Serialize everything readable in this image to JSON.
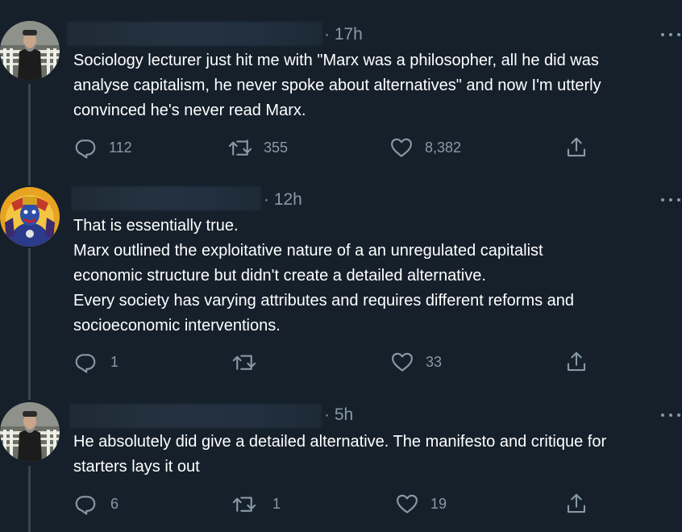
{
  "tweets": [
    {
      "time": "· 17h",
      "lines": [
        "Sociology lecturer just hit me with \"Marx was a philosopher, all he did was",
        "analyse capitalism, he never spoke about alternatives\" and now I'm utterly",
        "convinced he's never read Marx."
      ],
      "actions": {
        "reply": "112",
        "retweet": "355",
        "like": "8,382"
      }
    },
    {
      "time": "· 12h",
      "lines": [
        "That is essentially true.",
        "Marx outlined the exploitative nature of a an unregulated capitalist",
        "economic structure but didn't create a detailed alternative.",
        "Every society has varying attributes and requires different reforms and",
        "socioeconomic interventions."
      ],
      "actions": {
        "reply": "1",
        "retweet": "",
        "like": "33"
      }
    },
    {
      "time": "· 5h",
      "lines": [
        "He absolutely did give a detailed alternative. The manifesto and critique for",
        "starters lays it out"
      ],
      "actions": {
        "reply": "6",
        "retweet": "1",
        "like": "19"
      }
    }
  ],
  "colors": {
    "background": "#15202b",
    "text": "#ffffff",
    "secondary": "#8899a6",
    "thread_line": "#38444d"
  },
  "icons": [
    "reply-icon",
    "retweet-icon",
    "like-icon",
    "share-icon",
    "more-icon"
  ]
}
